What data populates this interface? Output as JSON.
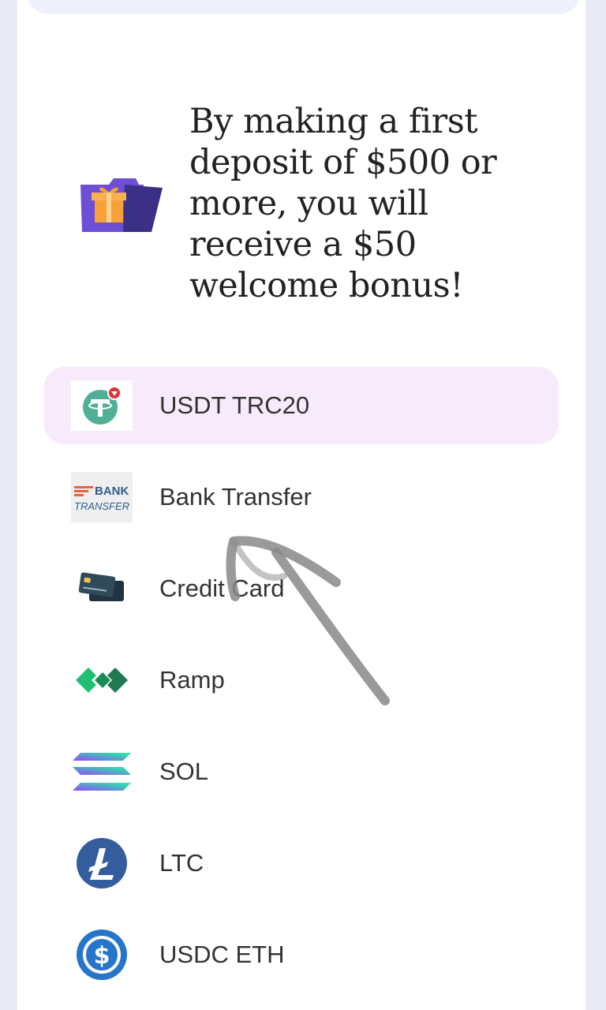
{
  "promo": {
    "text": "By making a first deposit of $500 or more, you will receive a $50 welcome bonus!",
    "icon": "gift-folder-icon"
  },
  "payment_methods": [
    {
      "label": "USDT TRC20",
      "icon": "usdt-icon",
      "selected": true
    },
    {
      "label": "Bank Transfer",
      "icon": "bank-transfer-icon",
      "icon_text_top": "BANK",
      "icon_text_bottom": "TRANSFER"
    },
    {
      "label": "Credit Card",
      "icon": "credit-card-icon"
    },
    {
      "label": "Ramp",
      "icon": "ramp-icon"
    },
    {
      "label": "SOL",
      "icon": "sol-icon"
    },
    {
      "label": "LTC",
      "icon": "ltc-icon"
    },
    {
      "label": "USDC ETH",
      "icon": "usdc-icon"
    }
  ],
  "colors": {
    "selected_bg": "#f7eafa",
    "usdt": "#50af95",
    "ramp": "#21bf73",
    "ltc": "#345d9d",
    "usdc": "#2775ca",
    "page_bg": "#e8ebf5"
  }
}
